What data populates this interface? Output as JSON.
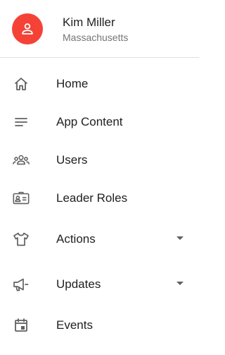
{
  "profile": {
    "name": "Kim Miller",
    "subtitle": "Massachusetts",
    "avatar_icon": "person-icon",
    "avatar_color": "#f44336"
  },
  "nav": {
    "items": [
      {
        "label": "Home",
        "icon": "home-icon",
        "expandable": false
      },
      {
        "label": "App Content",
        "icon": "notes-icon",
        "expandable": false
      },
      {
        "label": "Users",
        "icon": "people-icon",
        "expandable": false
      },
      {
        "label": "Leader Roles",
        "icon": "badge-icon",
        "expandable": false
      },
      {
        "label": "Actions",
        "icon": "shirt-icon",
        "expandable": true
      },
      {
        "label": "Updates",
        "icon": "megaphone-icon",
        "expandable": true
      },
      {
        "label": "Events",
        "icon": "calendar-icon",
        "expandable": false
      }
    ]
  },
  "colors": {
    "icon": "#616161",
    "text": "#212121",
    "secondary_text": "#757575",
    "divider": "#e0e0e0"
  }
}
